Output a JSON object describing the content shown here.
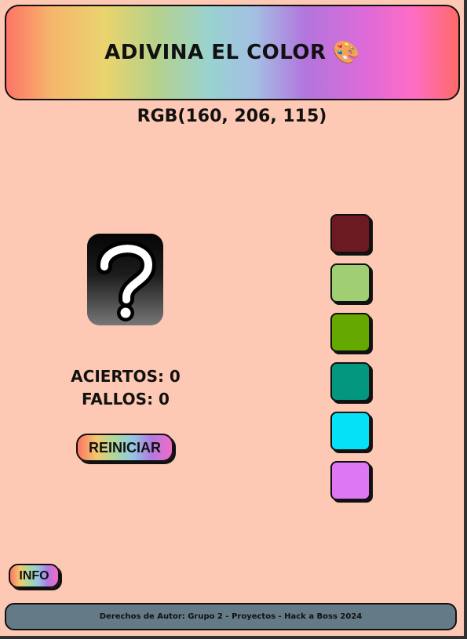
{
  "header": {
    "title": "ADIVINA EL COLOR",
    "icon": "palette-icon",
    "icon_glyph": "🎨"
  },
  "target": {
    "rgb_text": "RGB(160, 206, 115)"
  },
  "mystery": {
    "icon": "question-mark-icon"
  },
  "stats": {
    "aciertos_label": "ACIERTOS: 0",
    "fallos_label": "FALLOS: 0"
  },
  "buttons": {
    "reset_label": "REINICIAR",
    "info_label": "INFO"
  },
  "swatches": [
    "#6b1a21",
    "#a0ce73",
    "#64a800",
    "#04977f",
    "#05e2f5",
    "#de77f4"
  ],
  "footer": {
    "text": "Derechos de Autor: Grupo 2 - Proyectos - Hack a Boss 2024"
  }
}
